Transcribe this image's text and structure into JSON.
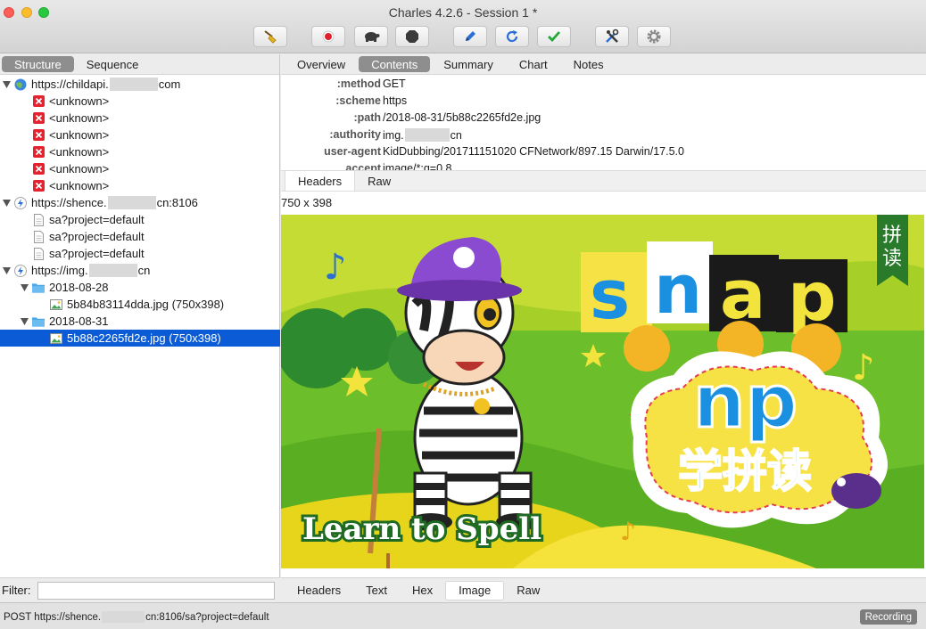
{
  "window": {
    "title": "Charles 4.2.6 - Session 1 *"
  },
  "toolbar": {
    "buttons": [
      {
        "icon": "broom-icon",
        "label": "clear"
      },
      {
        "icon": "record-icon",
        "label": "record",
        "color": "#e0212d"
      },
      {
        "icon": "turtle-icon",
        "label": "throttle"
      },
      {
        "icon": "hexagon-stop-icon",
        "label": "breakpoints"
      },
      {
        "icon": "pen-icon",
        "label": "compose",
        "color": "#2b6fd6"
      },
      {
        "icon": "refresh-icon",
        "label": "repeat",
        "color": "#2b6fd6"
      },
      {
        "icon": "check-icon",
        "label": "validate",
        "color": "#23a83a"
      },
      {
        "icon": "tools-icon",
        "label": "tools",
        "color": "#2b6fd6"
      },
      {
        "icon": "gear-icon",
        "label": "settings"
      }
    ]
  },
  "left_tabs": [
    "Structure",
    "Sequence"
  ],
  "tree": {
    "hosts": [
      {
        "prefix": "https://childapi.",
        "suffix": "com",
        "icon": "globe-icon",
        "children": [
          "<unknown>",
          "<unknown>",
          "<unknown>",
          "<unknown>",
          "<unknown>",
          "<unknown>"
        ]
      },
      {
        "prefix": "https://shence.",
        "suffix": "cn:8106",
        "icon": "lightning-icon",
        "children": [
          "sa?project=default",
          "sa?project=default",
          "sa?project=default"
        ]
      },
      {
        "prefix": "https://img.",
        "suffix": "cn",
        "icon": "lightning-icon",
        "folders": [
          {
            "name": "2018-08-28",
            "files": [
              "5b84b83114dda.jpg (750x398)"
            ]
          },
          {
            "name": "2018-08-31",
            "files": [
              "5b88c2265fd2e.jpg (750x398)"
            ]
          }
        ]
      }
    ]
  },
  "filter": {
    "label": "Filter:",
    "value": ""
  },
  "right_tabs": [
    "Overview",
    "Contents",
    "Summary",
    "Chart",
    "Notes"
  ],
  "request_headers": {
    "method": {
      "name": ":method",
      "value": "GET"
    },
    "scheme": {
      "name": ":scheme",
      "value": "https"
    },
    "path": {
      "name": ":path",
      "value": "/2018-08-31/5b88c2265fd2e.jpg"
    },
    "authority": {
      "name": ":authority",
      "prefix": "img.",
      "suffix": "cn"
    },
    "user_agent": {
      "name": "user-agent",
      "value": "KidDubbing/201711151020 CFNetwork/897.15 Darwin/17.5.0"
    },
    "accept": {
      "name": "accept",
      "value": "image/*;q=0.8"
    }
  },
  "request_subtabs": [
    "Headers",
    "Raw"
  ],
  "image_info": "750 x 398",
  "preview": {
    "snap_letters": [
      "s",
      "n",
      "a",
      "p"
    ],
    "cloud_title": "np",
    "cloud_subtitle": "学拼读",
    "banner": "拼读",
    "tagline": "Learn to Spell"
  },
  "response_tabs": [
    "Headers",
    "Text",
    "Hex",
    "Image",
    "Raw"
  ],
  "status": {
    "prefix": "POST https://shence.",
    "suffix": "cn:8106/sa?project=default",
    "recording": "Recording"
  }
}
